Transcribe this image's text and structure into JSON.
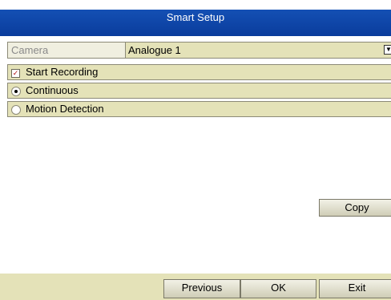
{
  "dialog": {
    "title": "Smart Setup"
  },
  "camera": {
    "label": "Camera",
    "value": "Analogue 1"
  },
  "options": {
    "start_recording": {
      "label": "Start Recording",
      "checked": true
    },
    "continuous": {
      "label": "Continuous",
      "selected": true
    },
    "motion_detection": {
      "label": "Motion Detection",
      "selected": false
    }
  },
  "buttons": {
    "copy": "Copy",
    "previous": "Previous",
    "ok": "OK",
    "exit": "Exit"
  },
  "icons": {
    "checkbox_mark": "✓",
    "dropdown_arrow": "▼"
  },
  "colors": {
    "title_bar": "#0a3c9c",
    "panel": "#e4e2b8",
    "label_disabled": "#8a8a8a"
  }
}
